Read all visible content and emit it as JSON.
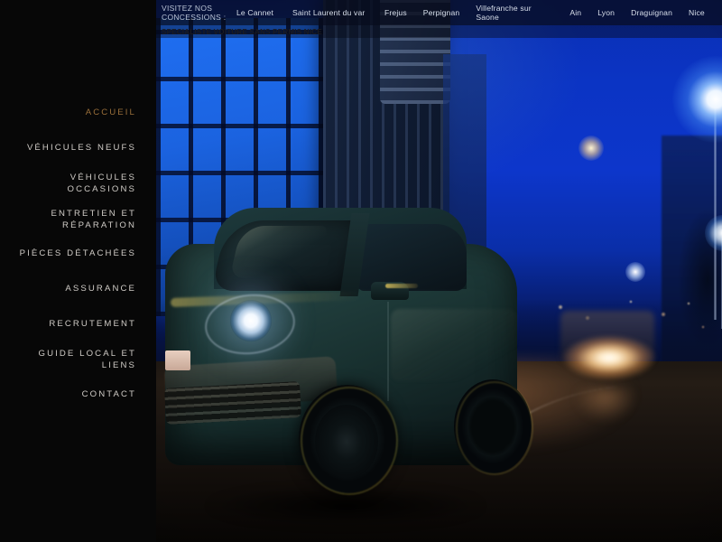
{
  "site": {
    "title": "Specialiste Voiture Sans Permis Nice",
    "accent_color": "#9a6f3a",
    "sidebar_bg": "#070707",
    "topbar_bg": "rgba(6,10,26,0.80)"
  },
  "topbar": {
    "label": "VISITEZ NOS CONCESSIONS :",
    "items": [
      {
        "label": "Le Cannet"
      },
      {
        "label": "Saint Laurent du var"
      },
      {
        "label": "Frejus"
      },
      {
        "label": "Perpignan"
      },
      {
        "label": "Villefranche sur Saone"
      },
      {
        "label": "Ain"
      },
      {
        "label": "Lyon"
      },
      {
        "label": "Draguignan"
      },
      {
        "label": "Nice"
      }
    ]
  },
  "subbar": {
    "text": "SPECIALISTE VOITURE SANS PERMIS NICE"
  },
  "sidebar": {
    "items": [
      {
        "label": "ACCUEIL",
        "active": true
      },
      {
        "label": "VÉHICULES NEUFS",
        "active": false
      },
      {
        "label": "VÉHICULES OCCASIONS",
        "active": false
      },
      {
        "label": "ENTRETIEN ET RÉPARATION",
        "line1": "ENTRETIEN ET",
        "line2": "RÉPARATION",
        "active": false
      },
      {
        "label": "PIÈCES DÉTACHÉES",
        "active": false
      },
      {
        "label": "ASSURANCE",
        "active": false
      },
      {
        "label": "RECRUTEMENT",
        "active": false
      },
      {
        "label": "GUIDE LOCAL ET LIENS",
        "active": false
      },
      {
        "label": "CONTACT",
        "active": false
      }
    ]
  },
  "hero": {
    "alt": "Voiture sans permis roulant de nuit en ville",
    "sky_color": "#0d36cb",
    "car_color": "#22403f",
    "road_color": "#1a1410"
  }
}
